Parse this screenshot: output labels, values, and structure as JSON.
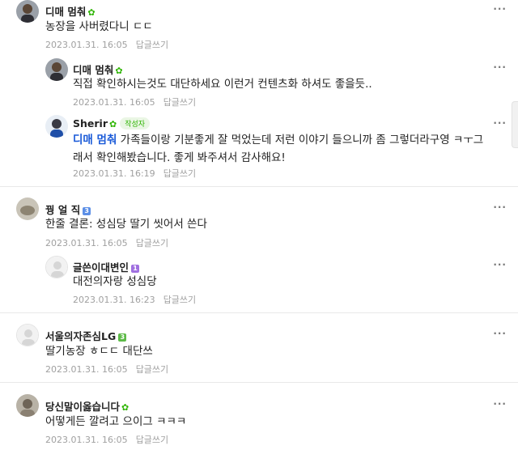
{
  "comments": [
    {
      "nick": "디매 멈춰",
      "body": "농장을 사버렸다니 ㄷㄷ",
      "date": "2023.01.31. 16:05"
    },
    {
      "nick": "디매 멈춰",
      "body": "직접 확인하시는것도 대단하세요 이런거 컨텐츠화 하셔도 좋을듯..",
      "date": "2023.01.31. 16:05"
    },
    {
      "nick": "Sherir",
      "badge": "작성자",
      "mention": "디매 멈춰",
      "body_line1": " 가족들이랑 기분좋게 잘 먹었는데 저런 이야기 들으니까 좀 그렇더라구영 ㅋㅜ그",
      "body_line2": "래서 확인해봤습니다. 좋게 봐주셔서 감사해요!",
      "date": "2023.01.31. 16:19"
    },
    {
      "nick": "꿩 얼 직",
      "level": "3",
      "body": "한줄 결론: 성심당 딸기 씻어서 쓴다",
      "date": "2023.01.31. 16:05"
    },
    {
      "nick": "글쓴이대변인",
      "level": "1",
      "body": "대전의자랑 성심당",
      "date": "2023.01.31. 16:23"
    },
    {
      "nick": "서울의자존심LG",
      "level": "3",
      "body": "딸기농장 ㅎㄷㄷ 대단쓰",
      "date": "2023.01.31. 16:05"
    },
    {
      "nick": "당신말이옳습니다",
      "body": "어떻게든 깔려고 으이그 ㅋㅋㅋ",
      "date": "2023.01.31. 16:05"
    }
  ],
  "reply_label": "답글쓰기",
  "more_label": "···",
  "leaf_glyph": "✿",
  "colors": {
    "mention": "#1a5ad8",
    "leaf": "#2db400",
    "meta": "#a0a0a0"
  }
}
